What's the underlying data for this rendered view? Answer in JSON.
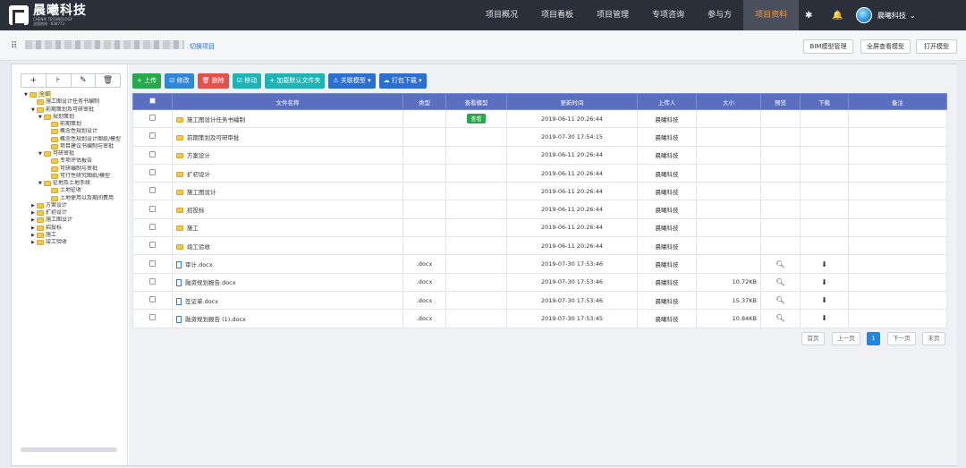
{
  "brand": {
    "title": "晨曦科技",
    "subtitle": "CHENXI TECHNOLOGY",
    "tel": "全国热线 · 838773"
  },
  "nav": [
    "项目概况",
    "项目看板",
    "项目管理",
    "专项咨询",
    "参与方",
    "项目资料"
  ],
  "user": {
    "name": "晨曦科技"
  },
  "icons": {
    "settings": "gear-icon",
    "bell": "bell-icon",
    "logout": "logout-icon"
  },
  "subbar": {
    "switch_label": "切换项目",
    "buttons": [
      "BIM模型管理",
      "全屏查看模型",
      "打开模型"
    ]
  },
  "tree_tools": [
    "+",
    "⊦",
    "✎",
    "🗑"
  ],
  "tree": [
    {
      "label": "全部",
      "level": 0,
      "open": true,
      "selected": true
    },
    {
      "label": "施工图设计任务书编制",
      "level": 1,
      "open": null
    },
    {
      "label": "前期策划及可研审批",
      "level": 1,
      "open": true
    },
    {
      "label": "规划策划",
      "level": 2,
      "open": true
    },
    {
      "label": "前期策划",
      "level": 3,
      "open": null
    },
    {
      "label": "概念性规划设计",
      "level": 3,
      "open": null
    },
    {
      "label": "概念性规划设计图纸/模型",
      "level": 3,
      "open": null
    },
    {
      "label": "项目建议书编制与审批",
      "level": 3,
      "open": null
    },
    {
      "label": "可研审批",
      "level": 2,
      "open": true
    },
    {
      "label": "专项评估报告",
      "level": 3,
      "open": null
    },
    {
      "label": "可研编制与审批",
      "level": 3,
      "open": null
    },
    {
      "label": "可行性研究图纸/模型",
      "level": 3,
      "open": null
    },
    {
      "label": "征地及土地手续",
      "level": 2,
      "open": true
    },
    {
      "label": "土地征收",
      "level": 3,
      "open": null
    },
    {
      "label": "土地使用以及期间费用",
      "level": 3,
      "open": null
    },
    {
      "label": "方案设计",
      "level": 1,
      "open": false
    },
    {
      "label": "扩初设计",
      "level": 1,
      "open": false
    },
    {
      "label": "施工图设计",
      "level": 1,
      "open": false
    },
    {
      "label": "招投标",
      "level": 1,
      "open": false
    },
    {
      "label": "施工",
      "level": 1,
      "open": false
    },
    {
      "label": "竣工验收",
      "level": 1,
      "open": false
    }
  ],
  "toolbar": [
    {
      "label": "+ 上传",
      "color": "green"
    },
    {
      "label": "☑ 修改",
      "color": "blue"
    },
    {
      "label": "🗑 删除",
      "color": "red"
    },
    {
      "label": "☑ 移动",
      "color": "teal"
    },
    {
      "label": "+ 加载默认文件夹",
      "color": "teal"
    },
    {
      "label": "⚠ 关联模型 ▾",
      "color": "navy"
    },
    {
      "label": "☁ 打包下载 ▾",
      "color": "navy"
    }
  ],
  "table": {
    "headers": [
      "文件名称",
      "类型",
      "查看模型",
      "更新时间",
      "上传人",
      "大小",
      "预览",
      "下载",
      "备注"
    ],
    "rows": [
      {
        "name": "施工图设计任务书编制",
        "kind": "folder",
        "type": "",
        "view": "查看",
        "time": "2019-06-11 20:26:44",
        "uploader": "晨曦科技",
        "size": "",
        "preview": false,
        "download": false
      },
      {
        "name": "前期策划及可研审批",
        "kind": "folder",
        "type": "",
        "view": "",
        "time": "2019-07-30 17:54:15",
        "uploader": "晨曦科技",
        "size": "",
        "preview": false,
        "download": false
      },
      {
        "name": "方案设计",
        "kind": "folder",
        "type": "",
        "view": "",
        "time": "2019-06-11 20:26:44",
        "uploader": "晨曦科技",
        "size": "",
        "preview": false,
        "download": false
      },
      {
        "name": "扩初设计",
        "kind": "folder",
        "type": "",
        "view": "",
        "time": "2019-06-11 20:26:44",
        "uploader": "晨曦科技",
        "size": "",
        "preview": false,
        "download": false
      },
      {
        "name": "施工图设计",
        "kind": "folder",
        "type": "",
        "view": "",
        "time": "2019-06-11 20:26:44",
        "uploader": "晨曦科技",
        "size": "",
        "preview": false,
        "download": false
      },
      {
        "name": "招投标",
        "kind": "folder",
        "type": "",
        "view": "",
        "time": "2019-06-11 20:26:44",
        "uploader": "晨曦科技",
        "size": "",
        "preview": false,
        "download": false
      },
      {
        "name": "施工",
        "kind": "folder",
        "type": "",
        "view": "",
        "time": "2019-06-11 20:26:44",
        "uploader": "晨曦科技",
        "size": "",
        "preview": false,
        "download": false
      },
      {
        "name": "竣工验收",
        "kind": "folder",
        "type": "",
        "view": "",
        "time": "2019-06-11 20:26:44",
        "uploader": "晨曦科技",
        "size": "",
        "preview": false,
        "download": false
      },
      {
        "name": "审计.docx",
        "kind": "doc",
        "type": ".docx",
        "view": "",
        "time": "2019-07-30 17:53:46",
        "uploader": "晨曦科技",
        "size": "",
        "preview": true,
        "download": true
      },
      {
        "name": "融资规划报告.docx",
        "kind": "doc",
        "type": ".docx",
        "view": "",
        "time": "2019-07-30 17:53:46",
        "uploader": "晨曦科技",
        "size": "10.72KB",
        "preview": true,
        "download": true
      },
      {
        "name": "签证单.docx",
        "kind": "doc",
        "type": ".docx",
        "view": "",
        "time": "2019-07-30 17:53:46",
        "uploader": "晨曦科技",
        "size": "15.37KB",
        "preview": true,
        "download": true
      },
      {
        "name": "融资规划报告 (1).docx",
        "kind": "doc",
        "type": ".docx",
        "view": "",
        "time": "2019-07-30 17:53:45",
        "uploader": "晨曦科技",
        "size": "10.84KB",
        "preview": true,
        "download": true
      }
    ]
  },
  "pager": {
    "first": "首页",
    "prev": "上一页",
    "current": "1",
    "next": "下一页",
    "last": "末页"
  }
}
